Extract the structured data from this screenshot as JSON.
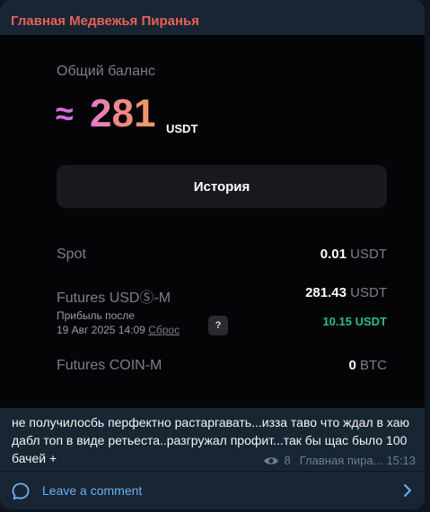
{
  "post": {
    "author": "Главная Медвежья Пиранья",
    "caption": "не получилосбь перфектно растаргавать...изза таво что ждал в хаю дабл топ в виде ретьеста..разгружал профит...так бы щас было 100 бачей +",
    "views": "8",
    "signature": "Главная пира...",
    "time": "15:13",
    "comment_label": "Leave a comment"
  },
  "screenshot": {
    "balance_title": "Общий баланс",
    "approx_symbol": "≈",
    "balance_value": "281",
    "balance_currency": "USDT",
    "history_button": "История",
    "rows": {
      "spot": {
        "label": "Spot",
        "value": "0.01",
        "currency": "USDT"
      },
      "futures_usd": {
        "label": "Futures USDⓈ-M",
        "value": "281.43",
        "currency": "USDT"
      },
      "futures_coin": {
        "label": "Futures COIN-M",
        "value": "0",
        "currency": "BTC"
      }
    },
    "profit": {
      "label": "Прибыль после",
      "date": "19 Авг 2025 14:09",
      "reset": "Сброс",
      "help": "?",
      "value": "10.15 USDT"
    }
  },
  "colors": {
    "author": "#e8605b",
    "link": "#6ab3f3",
    "profit": "#2fbd85"
  },
  "icons": [
    "eye-icon",
    "comment-icon",
    "chevron-right-icon",
    "help-icon"
  ]
}
